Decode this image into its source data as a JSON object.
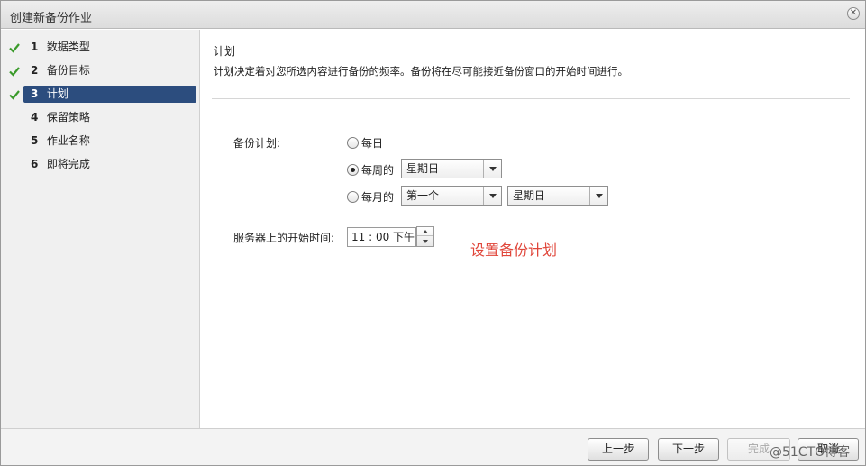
{
  "window": {
    "title": "创建新备份作业",
    "close_glyph": "✕"
  },
  "sidebar": {
    "steps": [
      {
        "num": "1",
        "label": "数据类型",
        "done": true
      },
      {
        "num": "2",
        "label": "备份目标",
        "done": true
      },
      {
        "num": "3",
        "label": "计划",
        "done": true,
        "active": true
      },
      {
        "num": "4",
        "label": "保留策略",
        "done": false
      },
      {
        "num": "5",
        "label": "作业名称",
        "done": false
      },
      {
        "num": "6",
        "label": "即将完成",
        "done": false
      }
    ],
    "check_color": "#3a9a2a",
    "active_color": "#2c4d7e"
  },
  "main": {
    "title": "计划",
    "description": "计划决定着对您所选内容进行备份的频率。备份将在尽可能接近备份窗口的开始时间进行。",
    "schedule_label": "备份计划:",
    "options": {
      "daily": "每日",
      "weekly": "每周的",
      "monthly": "每月的"
    },
    "selected_option": "weekly",
    "weekly_day": "星期日",
    "monthly_week": "第一个",
    "monthly_day": "星期日",
    "start_time_label": "服务器上的开始时间:",
    "start_time_value": "11 : 00 下午",
    "annotation": "设置备份计划",
    "annotation_color": "#e0463a"
  },
  "footer": {
    "prev": "上一步",
    "next": "下一步",
    "finish": "完成",
    "cancel": "取消",
    "watermark": "@51CTO博客"
  }
}
